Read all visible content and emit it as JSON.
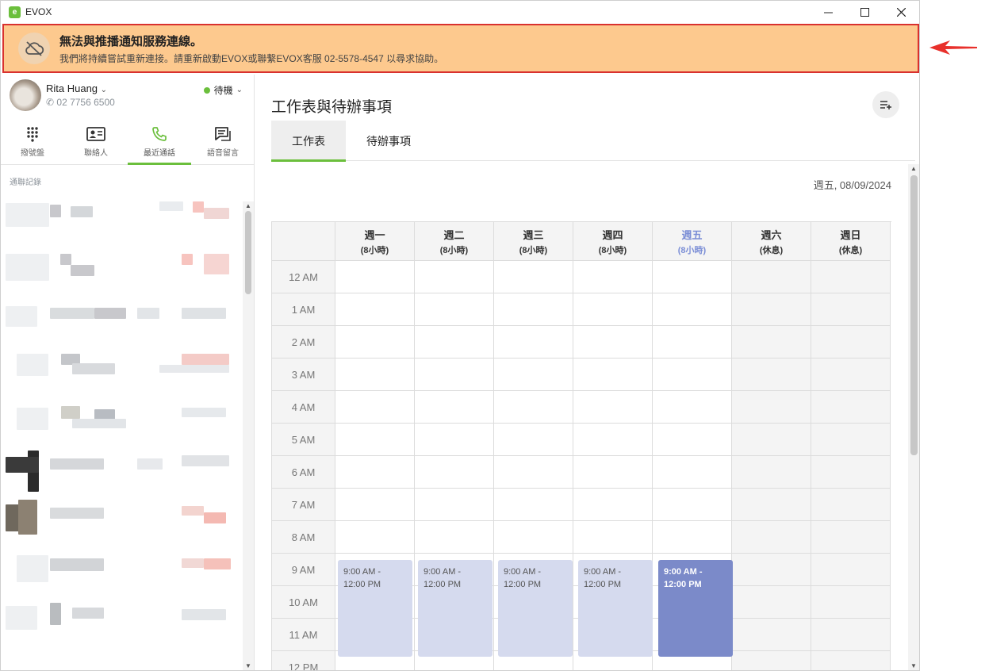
{
  "app": {
    "title": "EVOX",
    "logo_letter": "e"
  },
  "window_controls": {
    "minimize": "—",
    "maximize": "☐",
    "close": "✕"
  },
  "banner": {
    "title": "無法與推播通知服務連線。",
    "message": "我們將持續嘗試重新連接。請重新啟動EVOX或聯繫EVOX客服 02-5578-4547 以尋求協助。",
    "icon": "cloud-offline-icon",
    "bg_color": "#fdc98e",
    "border_color": "#d9312f"
  },
  "user": {
    "name": "Rita Huang",
    "name_chevron": "⌄",
    "phone": "02 7756 6500",
    "status": "待機",
    "status_color": "#6bbf3c"
  },
  "nav": {
    "items": [
      {
        "label": "撥號盤",
        "icon": "dialpad-icon"
      },
      {
        "label": "聯絡人",
        "icon": "contact-card-icon"
      },
      {
        "label": "最近通話",
        "icon": "phone-icon",
        "active": true
      },
      {
        "label": "語音留言",
        "icon": "voicemail-message-icon"
      }
    ],
    "accent": "#6bbf3c"
  },
  "recent_calls": {
    "heading": "通聯記錄"
  },
  "main": {
    "title": "工作表與待辦事項",
    "tabs": [
      {
        "label": "工作表",
        "active": true
      },
      {
        "label": "待辦事項"
      }
    ],
    "current_date": "週五, 08/09/2024"
  },
  "calendar": {
    "days": [
      {
        "name": "週一",
        "hours": "(8小時)"
      },
      {
        "name": "週二",
        "hours": "(8小時)"
      },
      {
        "name": "週三",
        "hours": "(8小時)"
      },
      {
        "name": "週四",
        "hours": "(8小時)"
      },
      {
        "name": "週五",
        "hours": "(8小時)",
        "today": true
      },
      {
        "name": "週六",
        "hours": "(休息)",
        "off": true
      },
      {
        "name": "週日",
        "hours": "(休息)",
        "off": true
      }
    ],
    "times": [
      "12 AM",
      "1 AM",
      "2 AM",
      "3 AM",
      "4 AM",
      "5 AM",
      "6 AM",
      "7 AM",
      "8 AM",
      "9 AM",
      "10 AM",
      "11 AM",
      "12 PM"
    ],
    "events": [
      {
        "day": 0,
        "label": "9:00 AM -\n12:00 PM"
      },
      {
        "day": 1,
        "label": "9:00 AM -\n12:00 PM"
      },
      {
        "day": 2,
        "label": "9:00 AM -\n12:00 PM"
      },
      {
        "day": 3,
        "label": "9:00 AM -\n12:00 PM"
      },
      {
        "day": 4,
        "label": "9:00 AM -\n12:00 PM",
        "today": true
      }
    ],
    "event_color": "#d5daee",
    "today_event_color": "#7b8ac9",
    "today_header_color": "#7b8ed6"
  }
}
